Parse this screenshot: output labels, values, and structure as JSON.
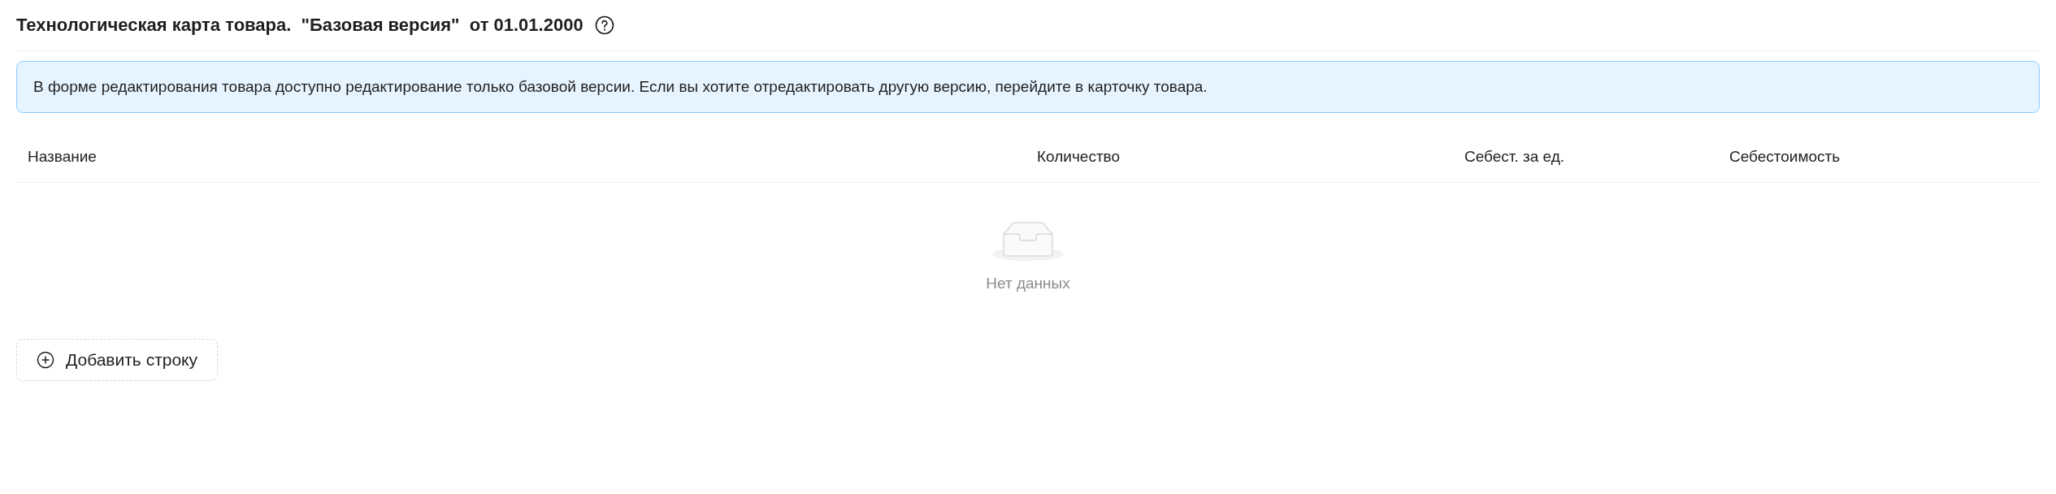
{
  "title": {
    "text": "Технологическая карта товара.  \"Базовая версия\"  от 01.01.2000"
  },
  "notice": "В форме редактирования товара доступно редактирование только базовой версии. Если вы хотите отредактировать другую версию, перейдите в карточку товара.",
  "table": {
    "columns": [
      "Название",
      "Количество",
      "Себест. за ед.",
      "Себестоимость"
    ],
    "empty_text": "Нет данных"
  },
  "add_button": "Добавить строку"
}
